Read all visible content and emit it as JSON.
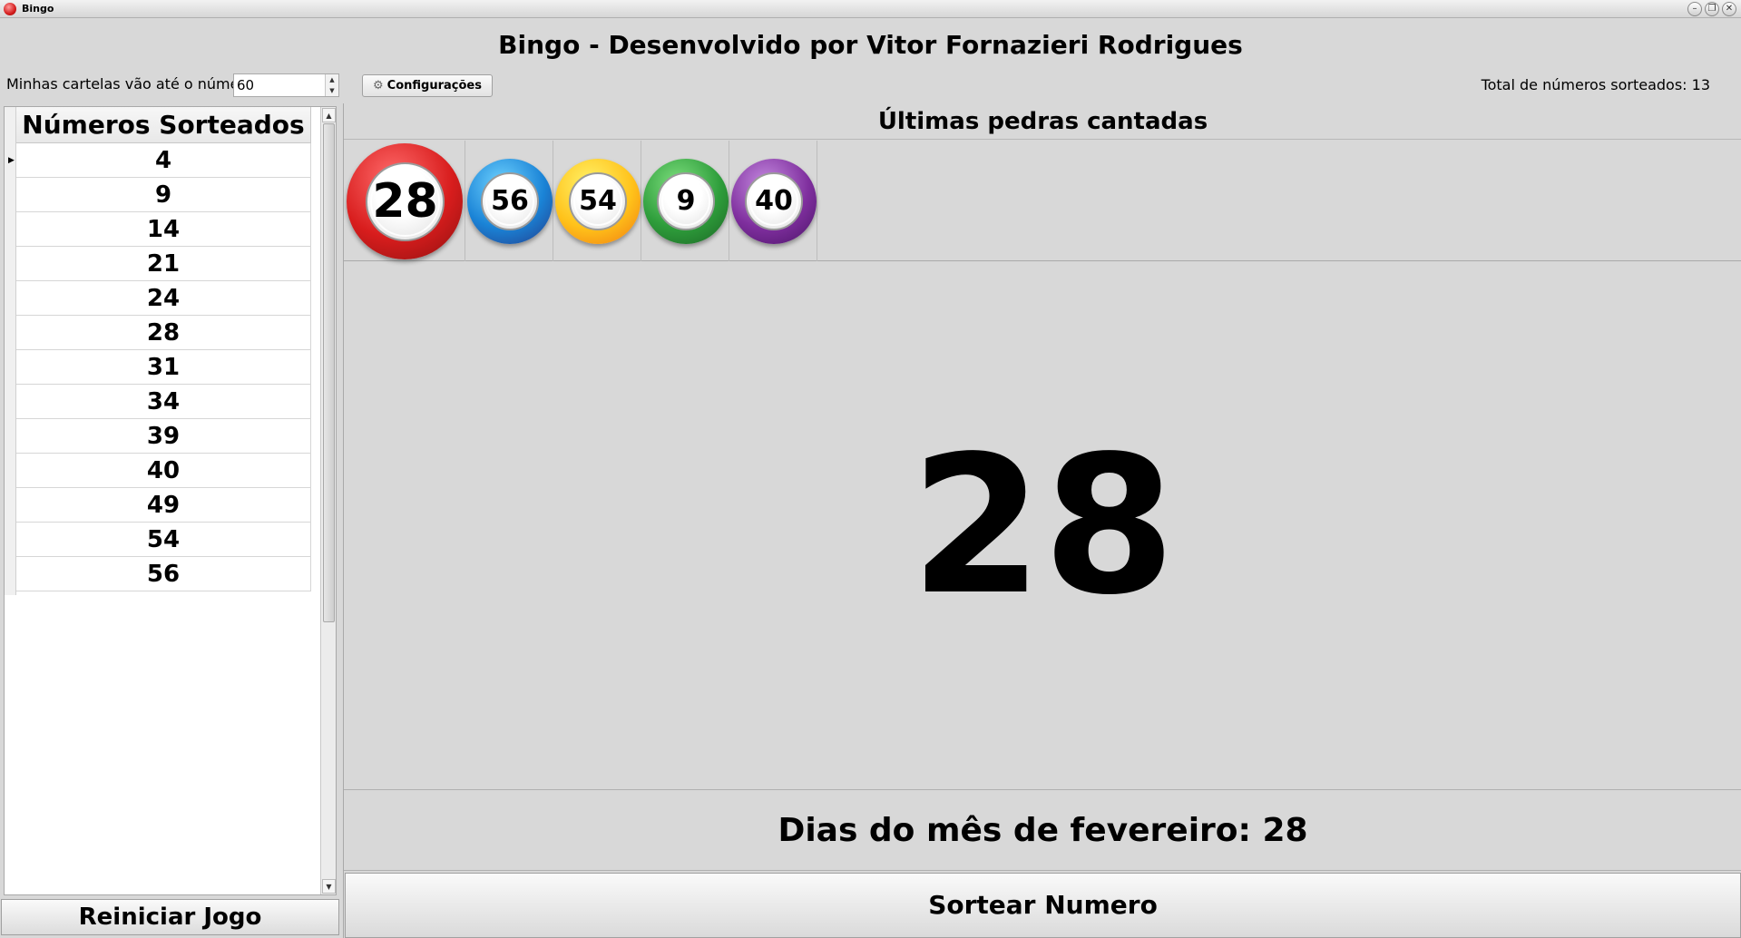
{
  "window": {
    "title": "Bingo",
    "minimize_glyph": "–",
    "restore_glyph": "❐",
    "close_glyph": "✕"
  },
  "header": {
    "title": "Bingo - Desenvolvido por Vitor Fornazieri Rodrigues"
  },
  "toolbar": {
    "max_label": "Minhas cartelas vão até o número:",
    "max_value": "60",
    "config_label": "Configurações",
    "config_icon": "gear-icon",
    "total_label": "Total de números sorteados: 13"
  },
  "drawn_list": {
    "header": "Números Sorteados",
    "rows": [
      "4",
      "9",
      "14",
      "21",
      "24",
      "28",
      "31",
      "34",
      "39",
      "40",
      "49",
      "54",
      "56"
    ]
  },
  "last_balls": {
    "header": "Últimas pedras cantadas",
    "balls": [
      {
        "number": "28",
        "color": "red"
      },
      {
        "number": "56",
        "color": "blue"
      },
      {
        "number": "54",
        "color": "yellow"
      },
      {
        "number": "9",
        "color": "green"
      },
      {
        "number": "40",
        "color": "purple"
      }
    ]
  },
  "current": {
    "number": "28",
    "fact": "Dias do mês de fevereiro: 28"
  },
  "buttons": {
    "reset": "Reiniciar Jogo",
    "draw": "Sortear Numero"
  }
}
